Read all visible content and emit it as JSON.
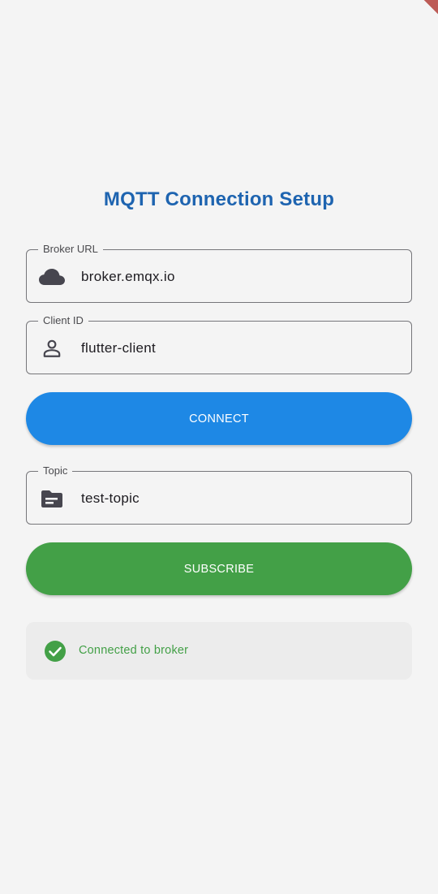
{
  "page": {
    "title": "MQTT Connection Setup"
  },
  "broker_field": {
    "label": "Broker URL",
    "value": "broker.emqx.io",
    "icon": "cloud-icon"
  },
  "client_field": {
    "label": "Client ID",
    "value": "flutter-client",
    "icon": "person-icon"
  },
  "connect_button": {
    "label": "CONNECT",
    "color": "#1e88e5"
  },
  "topic_field": {
    "label": "Topic",
    "value": "test-topic",
    "icon": "topic-icon"
  },
  "subscribe_button": {
    "label": "SUBSCRIBE",
    "color": "#43a047"
  },
  "status": {
    "text": "Connected to broker",
    "icon": "check-circle-icon",
    "color": "#43a047"
  },
  "colors": {
    "title": "#1e64b0",
    "background": "#f4f4f4",
    "status_card": "#ececec"
  }
}
